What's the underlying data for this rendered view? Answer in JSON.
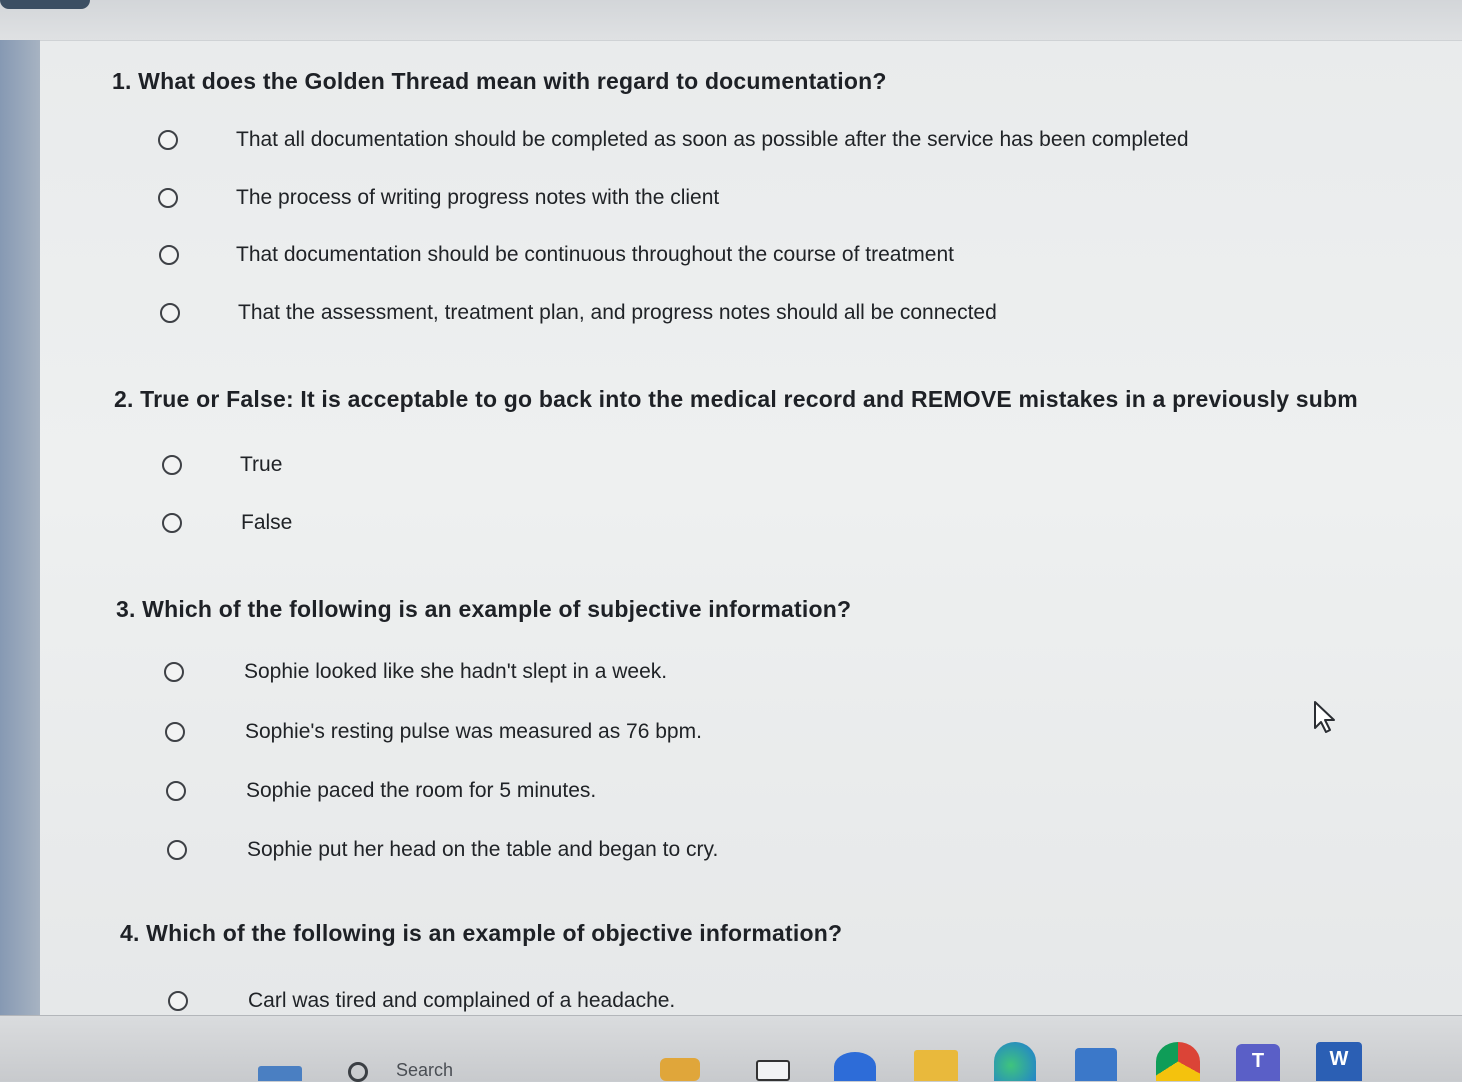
{
  "questions": [
    {
      "text": "1. What does the Golden Thread mean with regard to documentation?",
      "options": [
        "That all documentation should be completed as soon as possible after the service has been completed",
        "The process of writing progress notes with the client",
        "That documentation should be continuous throughout the course of treatment",
        "That the assessment, treatment plan, and progress notes should all be connected"
      ]
    },
    {
      "text": "2. True or False: It is acceptable to go back into the medical record and REMOVE mistakes in a previously subm",
      "options": [
        "True",
        "False"
      ]
    },
    {
      "text": "3. Which of the following is an example of subjective information?",
      "options": [
        "Sophie looked like she hadn't slept in a week.",
        "Sophie's resting pulse was measured as 76 bpm.",
        "Sophie paced the room for 5 minutes.",
        "Sophie put her head on the table and began to cry."
      ]
    },
    {
      "text": "4. Which of the following is an example of objective information?",
      "options": [
        "Carl was tired and complained of a headache."
      ]
    }
  ],
  "taskbar": {
    "search_text": "Search",
    "icons": [
      "widgets-icon",
      "search-icon",
      "file-explorer-icon",
      "task-view-icon",
      "zoom-icon",
      "folder-icon",
      "edge-icon",
      "store-icon",
      "chrome-icon",
      "teams-icon",
      "word-icon"
    ],
    "teams_letter": "T",
    "word_letter": "W"
  },
  "colors": {
    "page_background": "#eceeef",
    "text": "#1e2126",
    "radio_border": "#3e4146",
    "taskbar": "#d2d4d6"
  }
}
